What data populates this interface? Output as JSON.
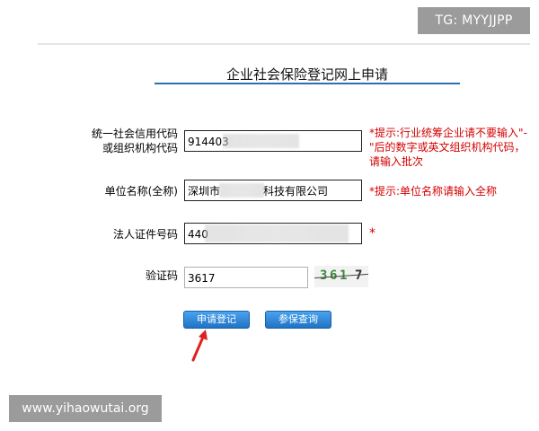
{
  "watermarks": {
    "top": "TG: MYYJJPP",
    "bottom": "www.yihaowutai.org"
  },
  "form": {
    "title": "企业社会保险登记网上申请",
    "credit_code": {
      "label_line1": "统一社会信用代码",
      "label_line2": "或组织机构代码",
      "value": "914403",
      "hint": "*提示:行业统筹企业请不要输入\"-\"后的数字或英文组织机构代码，请输入批次"
    },
    "company_name": {
      "label": "单位名称(全称)",
      "value_prefix": "深圳市",
      "value_suffix": "科技有限公司",
      "hint": "*提示:单位名称请输入全称"
    },
    "legal_id": {
      "label": "法人证件号码",
      "value": "440",
      "hint": "*"
    },
    "captcha": {
      "label": "验证码",
      "value": "3617",
      "image_text": [
        "3",
        "6",
        "1",
        "7"
      ]
    },
    "buttons": {
      "apply": "申请登记",
      "query": "参保查询"
    }
  },
  "colors": {
    "hint_red": "#d40000",
    "button_blue": "#2a82d4",
    "title_rule": "#2f6fb0",
    "arrow_red": "#e02020"
  },
  "icons": {
    "pointer": "red-arrow-icon"
  }
}
